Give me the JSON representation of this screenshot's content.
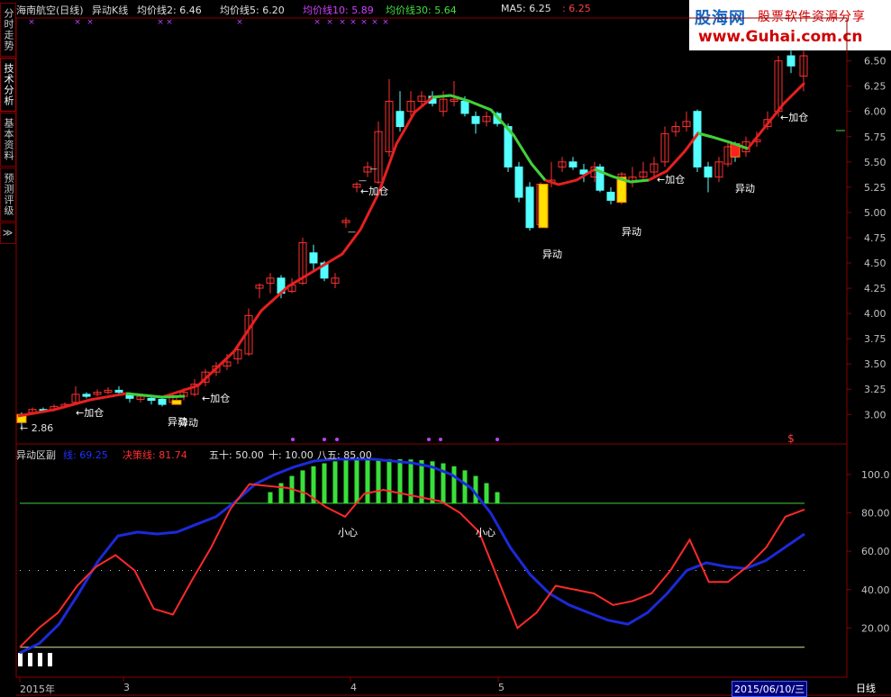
{
  "side_tabs": [
    "分时走势",
    "技术分析",
    "基本资料",
    "预测评级",
    "≫"
  ],
  "main_header": {
    "stock": "海南航空(日线)",
    "indicator": "异动K线",
    "ma2": "均价线2: 6.46",
    "ma5": "均价线5: 6.20",
    "ma10": "均价线10: 5.89",
    "ma30": "均价线30: 5.64",
    "ma5b": "MA5: 6.25",
    "ma5b_extra": ": 6.25"
  },
  "logo": {
    "brand": "股海网",
    "slogan": "股票软件资源分享",
    "url": "www.Guhai.com.cn"
  },
  "price_axis": [
    "6.50",
    "6.25",
    "6.00",
    "5.75",
    "5.50",
    "5.25",
    "5.00",
    "4.75",
    "4.50",
    "4.25",
    "4.00",
    "3.75",
    "3.50",
    "3.25",
    "3.00"
  ],
  "sub_axis": [
    "100.0",
    "80.00",
    "60.00",
    "40.00",
    "20.00"
  ],
  "annotations": {
    "low_price": "← 2.86",
    "add1": "←加仓",
    "add2": "←加仓",
    "add3": "←加仓",
    "add4": "←加仓",
    "add5": "←加仓",
    "move1": "异动",
    "move2": "异动",
    "move3": "异动",
    "move4": "异动",
    "move5": "异动"
  },
  "sub_header": {
    "name": "异动区副",
    "line1": "线: 69.25",
    "line2": "决策线: 81.74",
    "c50": "五十: 50.00",
    "c10": "十: 10.00",
    "c85": "八五: 85.00"
  },
  "sub_labels": {
    "careful1": "小心",
    "careful2": "小心"
  },
  "time_axis": {
    "year": "2015年",
    "m3": "3",
    "m4": "4",
    "m5": "5",
    "current": "2015/06/10/三",
    "period": "日线"
  },
  "colors": {
    "up": "#ff3030",
    "down": "#54ffff",
    "ma_red": "#e52020",
    "ma_green": "#3ad43a",
    "blue": "#1c2ad8",
    "frame": "#8a0000"
  },
  "chart_data": [
    {
      "type": "line",
      "title": "海南航空(日线) 异动K线",
      "ylim": [
        2.8,
        6.6
      ],
      "series": [
        {
          "name": "均价线",
          "values": [
            3.02,
            3.04,
            3.06,
            3.08,
            3.12,
            3.18,
            3.22,
            3.2,
            3.16,
            3.14,
            3.14,
            3.2,
            3.4,
            3.7,
            4.0,
            4.2,
            4.35,
            4.45,
            4.6,
            4.85,
            5.2,
            5.65,
            6.0,
            6.1,
            6.12,
            6.05,
            5.95,
            5.8,
            5.55,
            5.3,
            5.25,
            5.3,
            5.38,
            5.32,
            5.3,
            5.45,
            5.6,
            5.75,
            5.65,
            5.6,
            5.7,
            5.85,
            6.05,
            6.25
          ]
        }
      ]
    },
    {
      "type": "line",
      "title": "异动区副",
      "ylim": [
        0,
        110
      ],
      "series": [
        {
          "name": "线",
          "values": [
            7,
            12,
            22,
            38,
            55,
            68,
            70,
            69,
            70,
            74,
            78,
            86,
            95,
            100,
            104,
            107,
            108,
            108,
            108,
            107,
            106,
            104,
            100,
            93,
            80,
            62,
            48,
            38,
            32,
            28,
            24,
            22,
            28,
            38,
            50,
            54,
            52,
            51,
            55,
            62,
            69
          ]
        },
        {
          "name": "决策线",
          "values": [
            10,
            20,
            28,
            42,
            52,
            58,
            50,
            30,
            27,
            45,
            62,
            82,
            95,
            94,
            93,
            90,
            83,
            78,
            90,
            92,
            90,
            88,
            86,
            80,
            70,
            45,
            20,
            28,
            42,
            40,
            38,
            32,
            34,
            38,
            50,
            66,
            44,
            44,
            52,
            62,
            78,
            81.74
          ]
        }
      ]
    }
  ]
}
